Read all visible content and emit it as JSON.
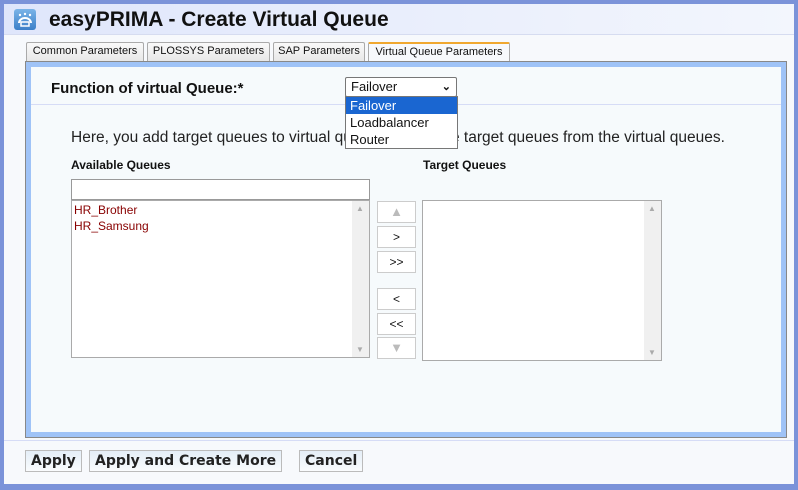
{
  "window": {
    "title": "easyPRIMA - Create Virtual Queue",
    "logo_icon": "easyprima-logo"
  },
  "tabs": [
    {
      "label": "Common Parameters",
      "active": false
    },
    {
      "label": "PLOSSYS Parameters",
      "active": false
    },
    {
      "label": "SAP Parameters",
      "active": false
    },
    {
      "label": "Virtual Queue Parameters",
      "active": true
    }
  ],
  "form": {
    "function_label": "Function of virtual Queue:*",
    "function_value": "Failover",
    "function_options": [
      "Failover",
      "Loadbalancer",
      "Router"
    ],
    "help_text": "Here, you add target queues to virtual queues or remove target queues from the virtual queues.",
    "available_label": "Available Queues",
    "available_filter": "",
    "available_items": [
      "HR_Brother",
      "HR_Samsung"
    ],
    "target_label": "Target Queues",
    "target_items": [],
    "move_buttons": {
      "up": "▲",
      "add": ">",
      "add_all": ">>",
      "remove": "<",
      "remove_all": "<<",
      "down": "▼"
    }
  },
  "footer": {
    "apply": "Apply",
    "apply_more": "Apply and Create More",
    "cancel": "Cancel"
  },
  "colors": {
    "frame": "#7b93d9",
    "panel_border": "#9fc3f7",
    "active_tab_accent": "#f0a830",
    "selected_option": "#1a66d1",
    "queue_text": "#880000"
  }
}
